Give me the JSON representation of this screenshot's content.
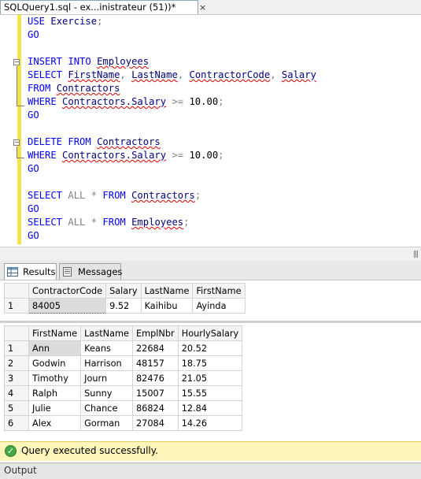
{
  "tab": {
    "title": "SQLQuery1.sql - ex...inistrateur (51))*",
    "close": "×"
  },
  "editor": {
    "lines": [
      [
        {
          "t": "USE ",
          "c": "kw"
        },
        {
          "t": "Exercise",
          "c": "id"
        },
        {
          "t": ";",
          "c": "op"
        }
      ],
      [
        {
          "t": "GO",
          "c": "kw"
        }
      ],
      [],
      [
        {
          "t": "INSERT INTO ",
          "c": "kw"
        },
        {
          "t": "Employees",
          "c": "id sq"
        }
      ],
      [
        {
          "t": "SELECT ",
          "c": "kw"
        },
        {
          "t": "FirstName",
          "c": "id sq"
        },
        {
          "t": ", ",
          "c": "op"
        },
        {
          "t": "LastName",
          "c": "id sq"
        },
        {
          "t": ", ",
          "c": "op"
        },
        {
          "t": "ContractorCode",
          "c": "id sq"
        },
        {
          "t": ", ",
          "c": "op"
        },
        {
          "t": "Salary",
          "c": "id sq"
        }
      ],
      [
        {
          "t": "FROM ",
          "c": "kw"
        },
        {
          "t": "Contractors",
          "c": "id sq"
        }
      ],
      [
        {
          "t": "WHERE ",
          "c": "kw"
        },
        {
          "t": "Contractors.Salary",
          "c": "id sq"
        },
        {
          "t": " >= ",
          "c": "op"
        },
        {
          "t": "10.00",
          "c": ""
        },
        {
          "t": ";",
          "c": "op"
        }
      ],
      [
        {
          "t": "GO",
          "c": "kw"
        }
      ],
      [],
      [
        {
          "t": "DELETE FROM ",
          "c": "kw"
        },
        {
          "t": "Contractors",
          "c": "id sq"
        }
      ],
      [
        {
          "t": "WHERE ",
          "c": "kw"
        },
        {
          "t": "Contractors.Salary",
          "c": "id sq"
        },
        {
          "t": " >= ",
          "c": "op"
        },
        {
          "t": "10.00",
          "c": ""
        },
        {
          "t": ";",
          "c": "op"
        }
      ],
      [
        {
          "t": "GO",
          "c": "kw"
        }
      ],
      [],
      [
        {
          "t": "SELECT ",
          "c": "kw"
        },
        {
          "t": "ALL * ",
          "c": "gray"
        },
        {
          "t": "FROM ",
          "c": "kw"
        },
        {
          "t": "Contractors",
          "c": "id sq"
        },
        {
          "t": ";",
          "c": "op"
        }
      ],
      [
        {
          "t": "GO",
          "c": "kw"
        }
      ],
      [
        {
          "t": "SELECT ",
          "c": "kw"
        },
        {
          "t": "ALL * ",
          "c": "gray"
        },
        {
          "t": "FROM ",
          "c": "kw"
        },
        {
          "t": "Employees",
          "c": "id sq"
        },
        {
          "t": ";",
          "c": "op"
        }
      ],
      [
        {
          "t": "GO",
          "c": "kw"
        }
      ]
    ]
  },
  "results": {
    "tabs": [
      {
        "label": "Results"
      },
      {
        "label": "Messages"
      }
    ],
    "grid1": {
      "columns": [
        "ContractorCode",
        "Salary",
        "LastName",
        "FirstName"
      ],
      "rows": [
        {
          "n": "1",
          "cells": [
            "84005",
            "9.52",
            "Kaihibu",
            "Ayinda"
          ]
        }
      ]
    },
    "grid2": {
      "columns": [
        "FirstName",
        "LastName",
        "EmplNbr",
        "HourlySalary"
      ],
      "rows": [
        {
          "n": "1",
          "cells": [
            "Ann",
            "Keans",
            "22684",
            "20.52"
          ]
        },
        {
          "n": "2",
          "cells": [
            "Godwin",
            "Harrison",
            "48157",
            "18.75"
          ]
        },
        {
          "n": "3",
          "cells": [
            "Timothy",
            "Journ",
            "82476",
            "21.05"
          ]
        },
        {
          "n": "4",
          "cells": [
            "Ralph",
            "Sunny",
            "15007",
            "15.55"
          ]
        },
        {
          "n": "5",
          "cells": [
            "Julie",
            "Chance",
            "86824",
            "12.84"
          ]
        },
        {
          "n": "6",
          "cells": [
            "Alex",
            "Gorman",
            "27084",
            "14.26"
          ]
        }
      ]
    }
  },
  "status": {
    "message": "Query executed successfully."
  },
  "output": {
    "label": "Output"
  }
}
